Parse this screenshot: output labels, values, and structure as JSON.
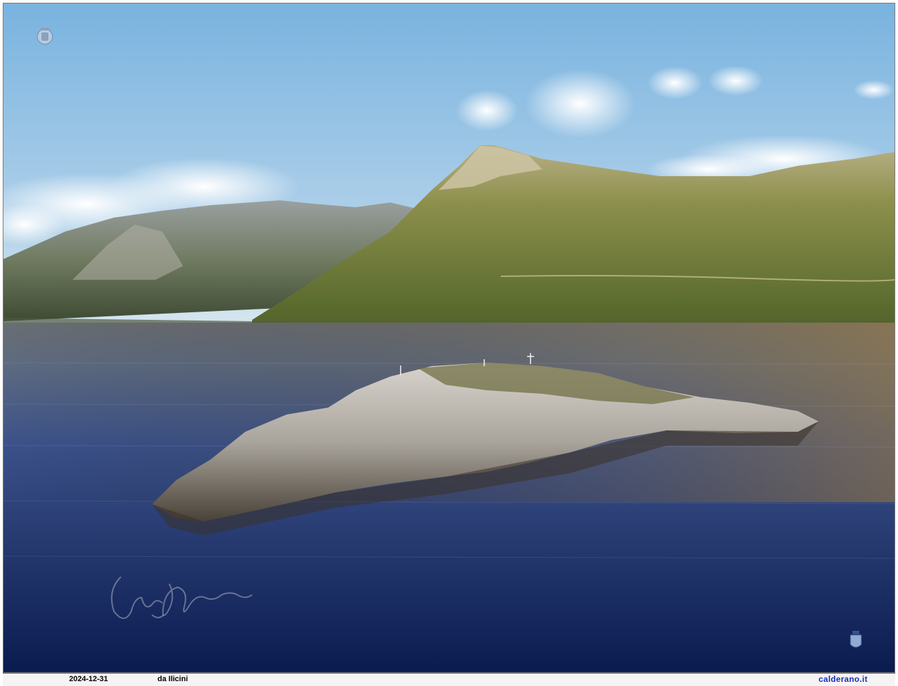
{
  "photo": {
    "caption_date": "2024-12-31",
    "caption_place": "da Ilicini",
    "site": "calderano.it",
    "watermark_signature": "A. Calderano"
  },
  "colors": {
    "sky_top": "#7fb6e0",
    "sky_bottom": "#cfe3ef",
    "sea_deep": "#0b1f55",
    "sea_mid": "#2f4c86",
    "mountain_green": "#6f7f3a",
    "rock": "#b7b3ad",
    "site_link": "#1a2fb8"
  }
}
